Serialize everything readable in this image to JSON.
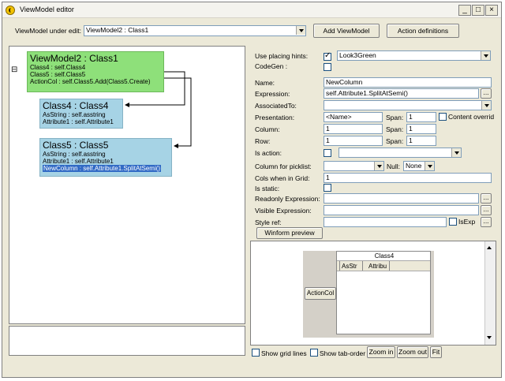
{
  "window": {
    "title": "ViewModel editor",
    "controls": [
      "_",
      "□",
      "×"
    ]
  },
  "top": {
    "vm_label": "ViewModel under edit:",
    "vm_value": "ViewModel2 : Class1",
    "add_vm": "Add ViewModel",
    "action_defs": "Action definitions"
  },
  "tree": {
    "collapse_glyph": "⊟",
    "nodes": [
      {
        "title": "ViewModel2 : Class1",
        "lines": [
          "Class4 : self.Class4",
          "Class5 : self.Class5",
          "ActionCol : self.Class5.Add(Class5.Create)"
        ]
      },
      {
        "title": "Class4 : Class4",
        "lines": [
          "AsString : self.asstring",
          "Attribute1 : self.Attribute1"
        ]
      },
      {
        "title": "Class5 : Class5",
        "lines": [
          "AsString : self.asstring",
          "Attribute1 : self.Attribute1",
          "NewColumn : self.Attribute1.SplitAtSemi()"
        ]
      }
    ]
  },
  "props": {
    "placing_hints_label": "Use placing hints:",
    "placing_hints_value": "Look3Green",
    "codegen_label": "CodeGen :",
    "name_label": "Name:",
    "name_value": "NewColumn",
    "expression_label": "Expression:",
    "expression_value": "self.Attribute1.SplitAtSemi()",
    "associated_label": "AssociatedTo:",
    "presentation_label": "Presentation:",
    "presentation_value": "<Name>",
    "span_label": "Span:",
    "span1": "1",
    "content_override": "Content overrid",
    "column_label": "Column:",
    "column_value": "1",
    "span2": "1",
    "row_label": "Row:",
    "row_value": "1",
    "span3": "1",
    "is_action_label": "Is action:",
    "picklist_label": "Column for picklist:",
    "null_label": "Null:",
    "null_value": "None",
    "cols_grid_label": "Cols when in Grid:",
    "cols_grid_value": "1",
    "is_static_label": "Is static:",
    "readonly_label": "Readonly Expression:",
    "visible_label": "Visible Expression:",
    "style_label": "Style ref:",
    "isexp_label": "IsExp",
    "ellipsis": "...",
    "winform_preview": "Winform preview"
  },
  "preview": {
    "grid_title": "Class4",
    "col1": "AsStr",
    "col2": "Attribu",
    "action_col": "ActionCol"
  },
  "bottom": {
    "show_grid_lines": "Show grid lines",
    "show_tab_order": "Show tab-order",
    "zoom_in": "Zoom in",
    "zoom_out": "Zoom out",
    "fit": "Fit"
  }
}
